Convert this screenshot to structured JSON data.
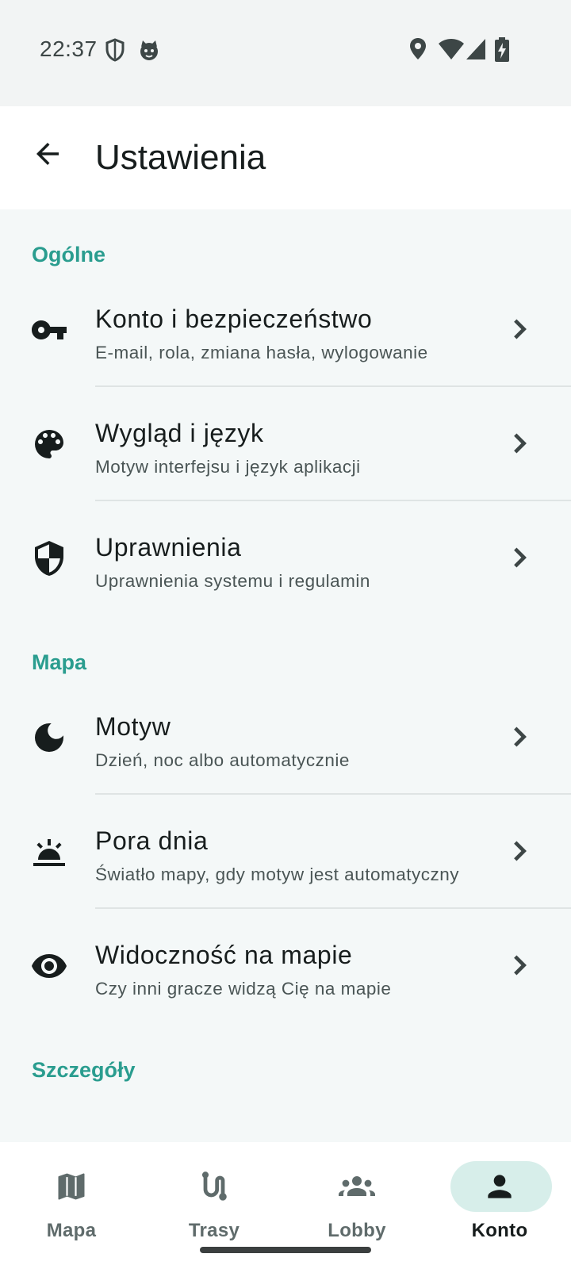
{
  "status_bar": {
    "time": "22:37",
    "left_icons": [
      "shield-outline-icon",
      "cat-face-icon"
    ],
    "right_icons": [
      "location-pin-icon",
      "wifi-icon",
      "cell-signal-icon",
      "battery-charging-icon"
    ]
  },
  "app_bar": {
    "back_icon": "arrow-back-icon",
    "title": "Ustawienia"
  },
  "sections": [
    {
      "header": "Ogólne",
      "items": [
        {
          "icon": "key-icon",
          "title": "Konto i bezpieczeństwo",
          "subtitle": "E-mail, rola, zmiana hasła, wylogowanie"
        },
        {
          "icon": "palette-icon",
          "title": "Wygląd i język",
          "subtitle": "Motyw interfejsu i język aplikacji"
        },
        {
          "icon": "shield-icon",
          "title": "Uprawnienia",
          "subtitle": "Uprawnienia systemu i regulamin"
        }
      ]
    },
    {
      "header": "Mapa",
      "items": [
        {
          "icon": "moon-icon",
          "title": "Motyw",
          "subtitle": "Dzień, noc albo automatycznie"
        },
        {
          "icon": "sunrise-icon",
          "title": "Pora dnia",
          "subtitle": "Światło mapy, gdy motyw jest automatyczny"
        },
        {
          "icon": "eye-icon",
          "title": "Widoczność na mapie",
          "subtitle": "Czy inni gracze widzą Cię na mapie"
        }
      ]
    },
    {
      "header": "Szczegóły",
      "items": []
    }
  ],
  "bottom_nav": {
    "items": [
      {
        "label": "Mapa",
        "icon": "map-icon",
        "active": false
      },
      {
        "label": "Trasy",
        "icon": "route-icon",
        "active": false
      },
      {
        "label": "Lobby",
        "icon": "groups-icon",
        "active": false
      },
      {
        "label": "Konto",
        "icon": "person-icon",
        "active": true
      }
    ]
  },
  "colors": {
    "accent": "#2a9d8f",
    "background": "#f4f8f8",
    "active_pill": "#d7eeea",
    "text_primary": "#171d1d",
    "text_secondary": "#4a5555"
  }
}
